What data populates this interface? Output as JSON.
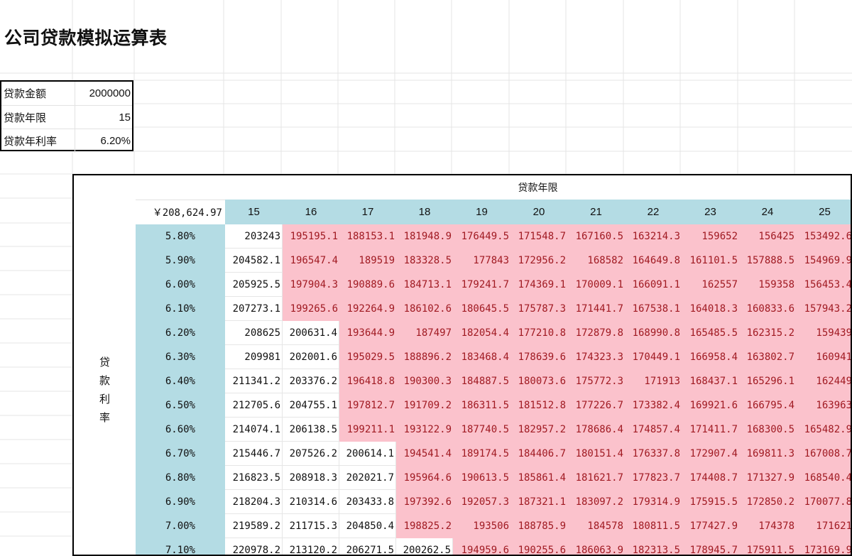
{
  "title": "公司贷款模拟运算表",
  "params": [
    {
      "label": "贷款金额",
      "value": "2000000"
    },
    {
      "label": "贷款年限",
      "value": "15"
    },
    {
      "label": "贷款年利率",
      "value": "6.20%"
    }
  ],
  "table": {
    "col_axis_label": "贷款年限",
    "row_axis_label": [
      "贷",
      "款",
      "利",
      "率"
    ],
    "corner_value": "￥208,624.97",
    "years": [
      "15",
      "16",
      "17",
      "18",
      "19",
      "20",
      "21",
      "22",
      "23",
      "24",
      "25"
    ],
    "colors": {
      "header": "#b4dce4",
      "highlight_bg": "#fbc2cc",
      "highlight_text": "#a01a22"
    },
    "rows": [
      {
        "rate": "5.80%",
        "plain_count": 1,
        "values": [
          "203243",
          "195195.1",
          "188153.1",
          "181948.9",
          "176449.5",
          "171548.7",
          "167160.5",
          "163214.3",
          "159652",
          "156425",
          "153492.6"
        ]
      },
      {
        "rate": "5.90%",
        "plain_count": 1,
        "values": [
          "204582.1",
          "196547.4",
          "189519",
          "183328.5",
          "177843",
          "172956.2",
          "168582",
          "164649.8",
          "161101.5",
          "157888.5",
          "154969.9"
        ]
      },
      {
        "rate": "6.00%",
        "plain_count": 1,
        "values": [
          "205925.5",
          "197904.3",
          "190889.6",
          "184713.1",
          "179241.7",
          "174369.1",
          "170009.1",
          "166091.1",
          "162557",
          "159358",
          "156453.4"
        ]
      },
      {
        "rate": "6.10%",
        "plain_count": 1,
        "values": [
          "207273.1",
          "199265.6",
          "192264.9",
          "186102.6",
          "180645.5",
          "175787.3",
          "171441.7",
          "167538.1",
          "164018.3",
          "160833.6",
          "157943.2"
        ]
      },
      {
        "rate": "6.20%",
        "plain_count": 2,
        "values": [
          "208625",
          "200631.4",
          "193644.9",
          "187497",
          "182054.4",
          "177210.8",
          "172879.8",
          "168990.8",
          "165485.5",
          "162315.2",
          "159439"
        ]
      },
      {
        "rate": "6.30%",
        "plain_count": 2,
        "values": [
          "209981",
          "202001.6",
          "195029.5",
          "188896.2",
          "183468.4",
          "178639.6",
          "174323.3",
          "170449.1",
          "166958.4",
          "163802.7",
          "160941"
        ]
      },
      {
        "rate": "6.40%",
        "plain_count": 2,
        "values": [
          "211341.2",
          "203376.2",
          "196418.8",
          "190300.3",
          "184887.5",
          "180073.6",
          "175772.3",
          "171913",
          "168437.1",
          "165296.1",
          "162449"
        ]
      },
      {
        "rate": "6.50%",
        "plain_count": 2,
        "values": [
          "212705.6",
          "204755.1",
          "197812.7",
          "191709.2",
          "186311.5",
          "181512.8",
          "177226.7",
          "173382.4",
          "169921.6",
          "166795.4",
          "163963"
        ]
      },
      {
        "rate": "6.60%",
        "plain_count": 2,
        "values": [
          "214074.1",
          "206138.5",
          "199211.1",
          "193122.9",
          "187740.5",
          "182957.2",
          "178686.4",
          "174857.4",
          "171411.7",
          "168300.5",
          "165482.9"
        ]
      },
      {
        "rate": "6.70%",
        "plain_count": 3,
        "values": [
          "215446.7",
          "207526.2",
          "200614.1",
          "194541.4",
          "189174.5",
          "184406.7",
          "180151.4",
          "176337.8",
          "172907.4",
          "169811.3",
          "167008.7"
        ]
      },
      {
        "rate": "6.80%",
        "plain_count": 3,
        "values": [
          "216823.5",
          "208918.3",
          "202021.7",
          "195964.6",
          "190613.5",
          "185861.4",
          "181621.7",
          "177823.7",
          "174408.7",
          "171327.9",
          "168540.4"
        ]
      },
      {
        "rate": "6.90%",
        "plain_count": 3,
        "values": [
          "218204.3",
          "210314.6",
          "203433.8",
          "197392.6",
          "192057.3",
          "187321.1",
          "183097.2",
          "179314.9",
          "175915.5",
          "172850.2",
          "170077.8"
        ]
      },
      {
        "rate": "7.00%",
        "plain_count": 3,
        "values": [
          "219589.2",
          "211715.3",
          "204850.4",
          "198825.2",
          "193506",
          "188785.9",
          "184578",
          "180811.5",
          "177427.9",
          "174378",
          "171621"
        ]
      },
      {
        "rate": "7.10%",
        "plain_count": 4,
        "values": [
          "220978.2",
          "213120.2",
          "206271.5",
          "200262.5",
          "194959.6",
          "190255.6",
          "186063.9",
          "182313.5",
          "178945.7",
          "175911.5",
          "173169.9"
        ]
      }
    ]
  }
}
